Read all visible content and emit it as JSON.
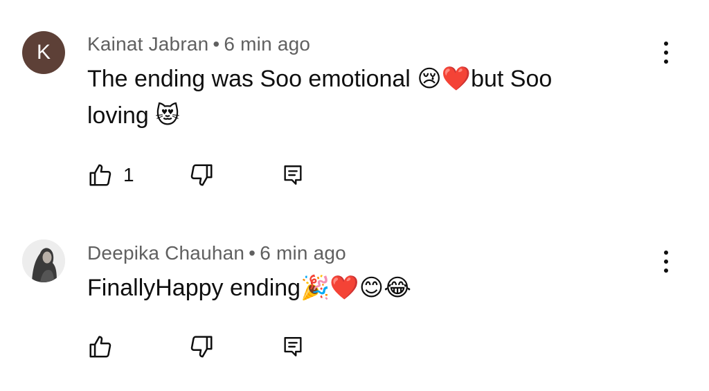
{
  "comments": [
    {
      "avatar_letter": "K",
      "avatar_color": "#5d4037",
      "author": "Kainat Jabran",
      "time": "6 min ago",
      "text_line1": "The ending was Soo emotional ",
      "emoji_a": "😢❤️",
      "text_after": "but Soo",
      "text_line2": "loving ",
      "emoji_b": "😻",
      "likes": "1"
    },
    {
      "avatar_icon": "profile-photo",
      "author": "Deepika Chauhan",
      "time": "6 min ago",
      "text": "FinallyHappy ending",
      "emoji": "🎉❤️😊😂",
      "likes": ""
    }
  ],
  "separator": "•",
  "icons": {
    "like": "thumb-up-icon",
    "dislike": "thumb-down-icon",
    "reply": "reply-comment-icon",
    "more": "more-vertical-icon"
  }
}
